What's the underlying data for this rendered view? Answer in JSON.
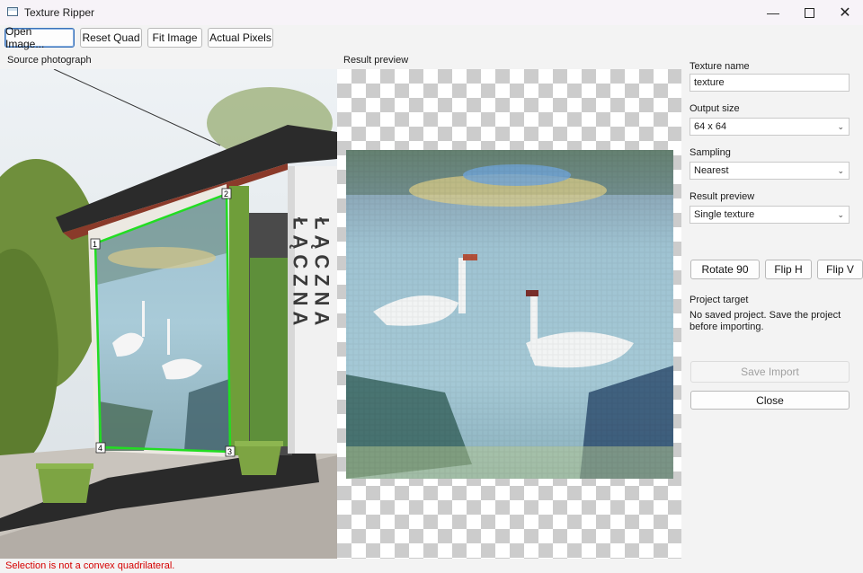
{
  "window": {
    "title": "Texture Ripper",
    "min_icon": "minimize-icon",
    "max_icon": "maximize-icon",
    "close_icon": "close-icon"
  },
  "toolbar": {
    "open": "Open Image...",
    "reset": "Reset Quad",
    "fit": "Fit Image",
    "actual": "Actual Pixels"
  },
  "source": {
    "label": "Source photograph",
    "sign_left": "ŁĄCZNA",
    "sign_right": "ŁĄCZNA",
    "handles": [
      "1",
      "2",
      "3",
      "4"
    ]
  },
  "preview": {
    "label": "Result preview"
  },
  "settings": {
    "texture_name_label": "Texture name",
    "texture_name_value": "texture",
    "output_size_label": "Output size",
    "output_size_value": "64 x 64",
    "sampling_label": "Sampling",
    "sampling_value": "Nearest",
    "result_preview_label": "Result preview",
    "result_preview_value": "Single texture",
    "rotate": "Rotate 90",
    "flip_h": "Flip H",
    "flip_v": "Flip V",
    "project_target_label": "Project target",
    "project_target_message": "No saved project. Save the project before importing.",
    "save_import": "Save  Import",
    "close": "Close"
  },
  "status": {
    "message": "Selection is not a convex quadrilateral."
  },
  "colors": {
    "quad": "#22dd22",
    "error": "#d60000",
    "focus": "#3b73b9"
  }
}
